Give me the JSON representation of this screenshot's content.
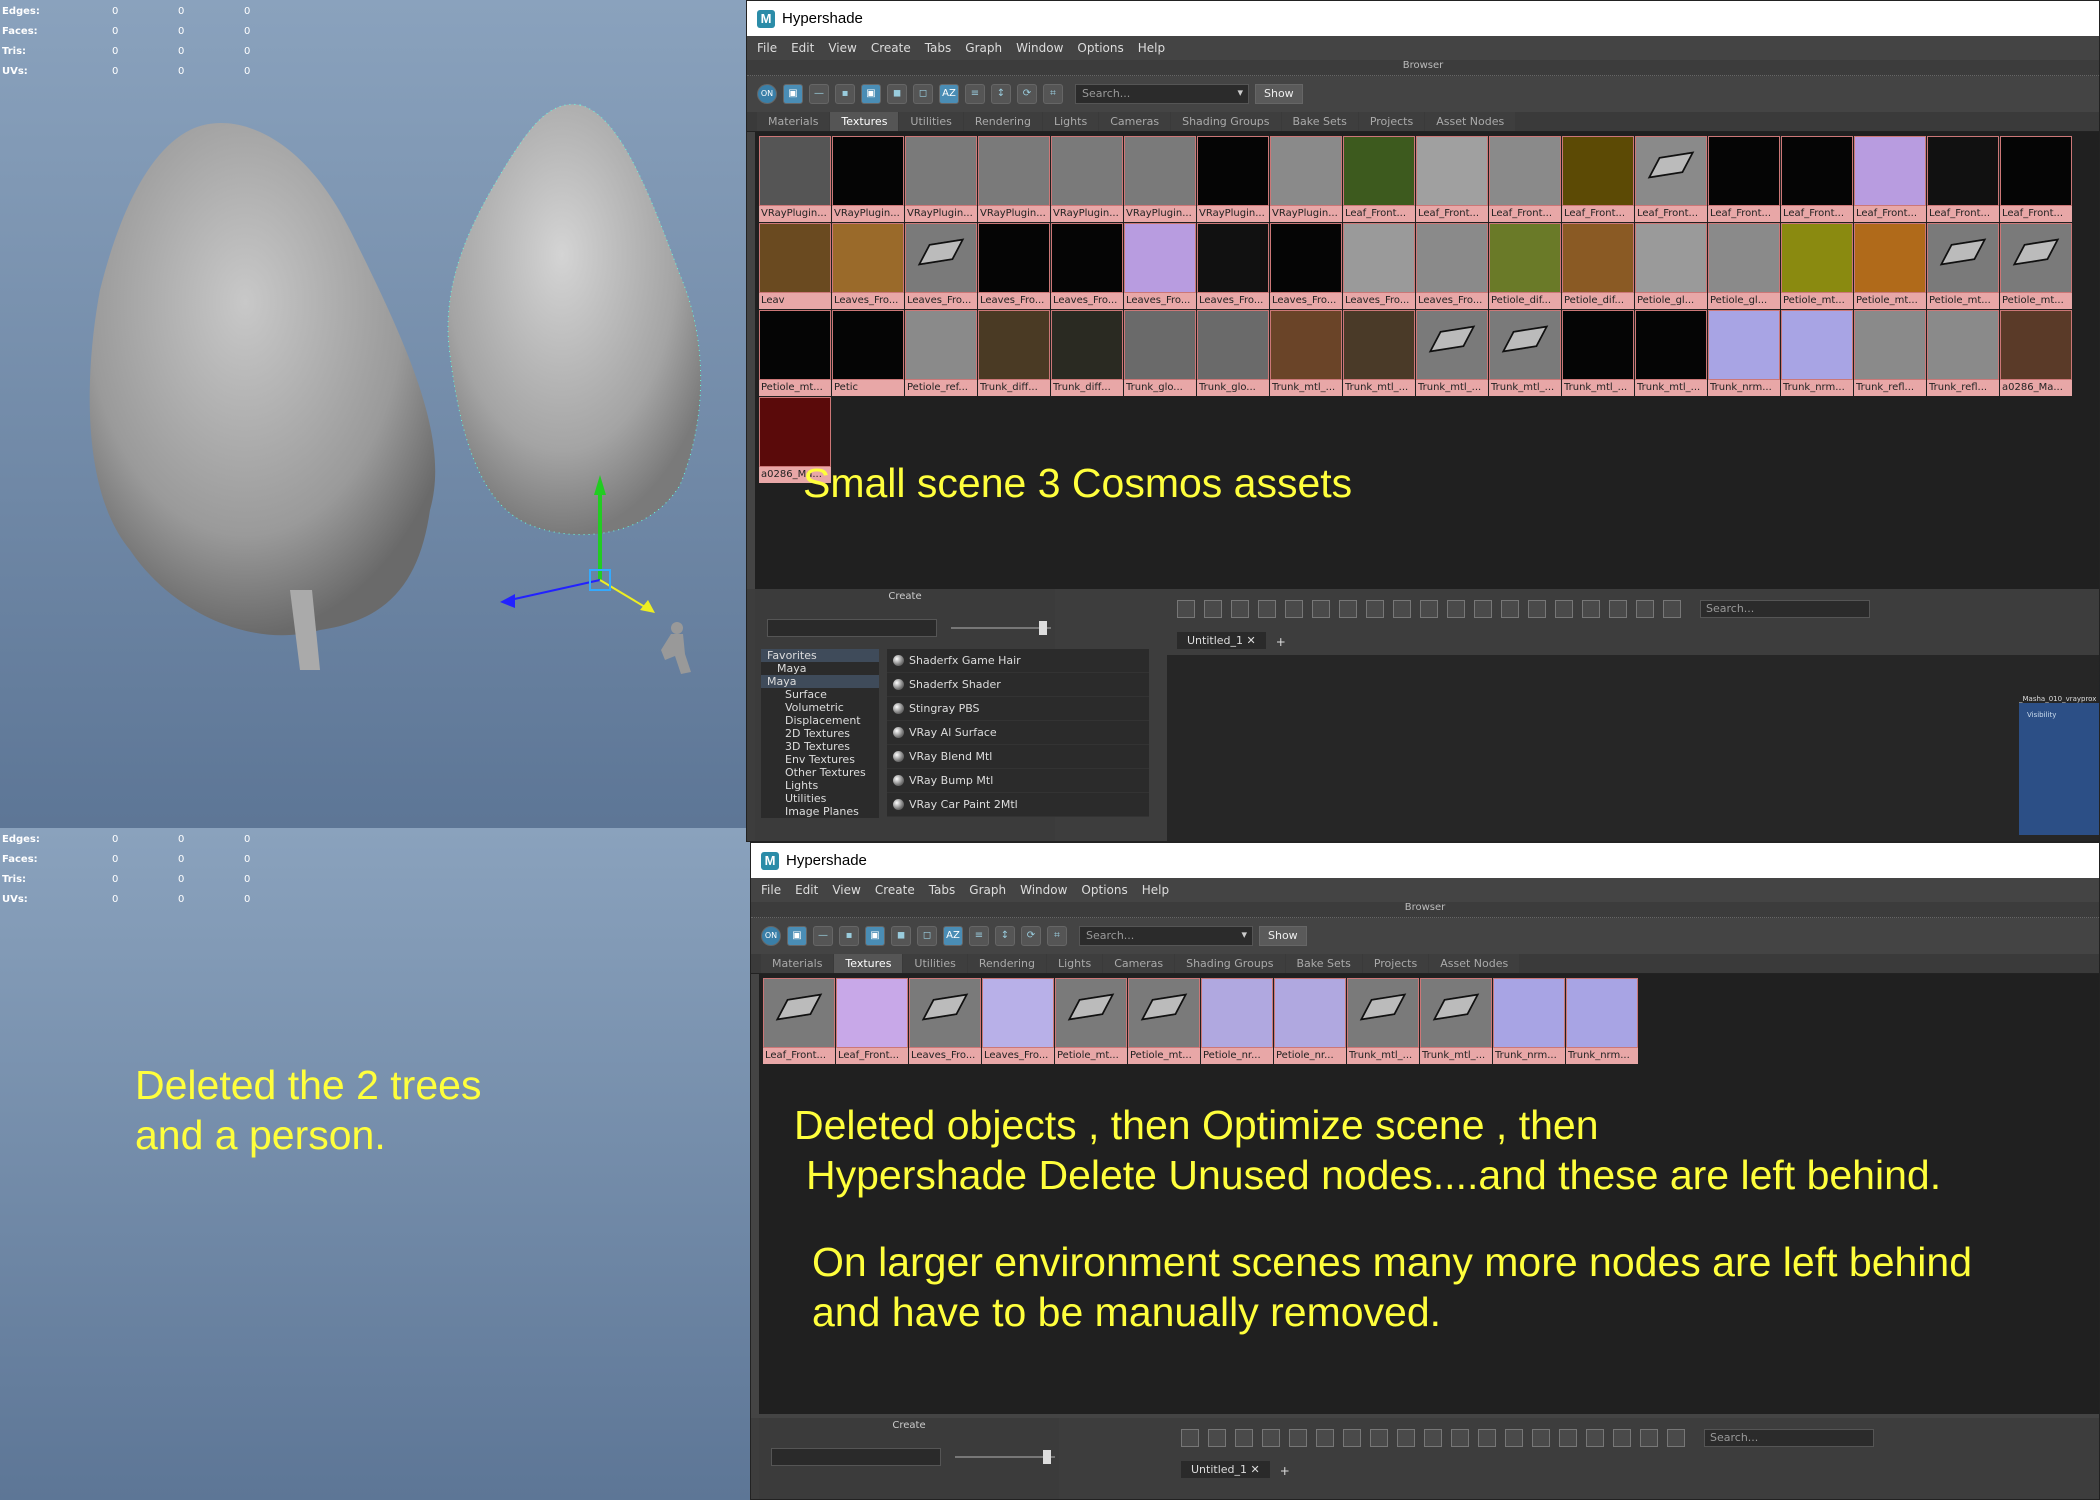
{
  "stats": {
    "rows": [
      {
        "label": "Edges:",
        "values": [
          "0",
          "0",
          "0"
        ]
      },
      {
        "label": "Faces:",
        "values": [
          "0",
          "0",
          "0"
        ]
      },
      {
        "label": "Tris:",
        "values": [
          "0",
          "0",
          "0"
        ]
      },
      {
        "label": "UVs:",
        "values": [
          "0",
          "0",
          "0"
        ]
      }
    ]
  },
  "top_window": {
    "title": "Hypershade",
    "menu": [
      "File",
      "Edit",
      "View",
      "Create",
      "Tabs",
      "Graph",
      "Window",
      "Options",
      "Help"
    ],
    "browser_label": "Browser",
    "search_placeholder": "Search...",
    "show_label": "Show",
    "tabs": [
      "Materials",
      "Textures",
      "Utilities",
      "Rendering",
      "Lights",
      "Cameras",
      "Shading Groups",
      "Bake Sets",
      "Projects",
      "Asset Nodes"
    ],
    "active_tab": "Textures",
    "swatches": [
      {
        "label": "VRayPlugin...",
        "color": "#555555"
      },
      {
        "label": "VRayPlugin...",
        "color": "#050505"
      },
      {
        "label": "VRayPlugin...",
        "color": "#7a7a7a"
      },
      {
        "label": "VRayPlugin...",
        "color": "#7a7a7a"
      },
      {
        "label": "VRayPlugin...",
        "color": "#7a7a7a"
      },
      {
        "label": "VRayPlugin...",
        "color": "#7a7a7a"
      },
      {
        "label": "VRayPlugin...",
        "color": "#050505"
      },
      {
        "label": "VRayPlugin...",
        "color": "#8a8a8a"
      },
      {
        "label": "Leaf_Front...",
        "color": "#3d5a1e"
      },
      {
        "label": "Leaf_Front...",
        "color": "#a0a0a0"
      },
      {
        "label": "Leaf_Front...",
        "color": "#8a8a8a"
      },
      {
        "label": "Leaf_Front...",
        "color": "#5c4a05"
      },
      {
        "label": "Leaf_Front...",
        "color": "#8a8a8a",
        "glyph": true
      },
      {
        "label": "Leaf_Front...",
        "color": "#050505"
      },
      {
        "label": "Leaf_Front...",
        "color": "#050505"
      },
      {
        "label": "Leaf_Front...",
        "color": "#b89ce0"
      },
      {
        "label": "Leaf_Front...",
        "color": "#111111"
      },
      {
        "label": "Leaf_Front...",
        "color": "#050505"
      },
      {
        "label": "Leav",
        "color": "#6a4a20"
      },
      {
        "label": "Leaves_Fro...",
        "color": "#9a6a2a"
      },
      {
        "label": "Leaves_Fro...",
        "color": "#7a7a7a",
        "glyph": true
      },
      {
        "label": "Leaves_Fro...",
        "color": "#050505"
      },
      {
        "label": "Leaves_Fro...",
        "color": "#050505"
      },
      {
        "label": "Leaves_Fro...",
        "color": "#b89ce0"
      },
      {
        "label": "Leaves_Fro...",
        "color": "#111111"
      },
      {
        "label": "Leaves_Fro...",
        "color": "#050505"
      },
      {
        "label": "Leaves_Fro...",
        "color": "#9a9a9a"
      },
      {
        "label": "Leaves_Fro...",
        "color": "#8a8a8a"
      },
      {
        "label": "Petiole_dif...",
        "color": "#6a7a28"
      },
      {
        "label": "Petiole_dif...",
        "color": "#8a5a24"
      },
      {
        "label": "Petiole_gl...",
        "color": "#9a9a9a"
      },
      {
        "label": "Petiole_gl...",
        "color": "#8a8a8a"
      },
      {
        "label": "Petiole_mt...",
        "color": "#8a8a10"
      },
      {
        "label": "Petiole_mt...",
        "color": "#b06a1a"
      },
      {
        "label": "Petiole_mt...",
        "color": "#7a7a7a",
        "glyph": true
      },
      {
        "label": "Petiole_mt...",
        "color": "#7a7a7a",
        "glyph": true
      },
      {
        "label": "Petiole_mt...",
        "color": "#050505"
      },
      {
        "label": "Petic",
        "color": "#050505"
      },
      {
        "label": "Petiole_ref...",
        "color": "#8a8a8a"
      },
      {
        "label": "Trunk_diff...",
        "color": "#4a3a24"
      },
      {
        "label": "Trunk_diff...",
        "color": "#2a2a22"
      },
      {
        "label": "Trunk_glo...",
        "color": "#6a6a6a"
      },
      {
        "label": "Trunk_glo...",
        "color": "#6a6a6a"
      },
      {
        "label": "Trunk_mtl_...",
        "color": "#6a4428"
      },
      {
        "label": "Trunk_mtl_...",
        "color": "#4a3a28"
      },
      {
        "label": "Trunk_mtl_...",
        "color": "#7a7a7a",
        "glyph": true
      },
      {
        "label": "Trunk_mtl_...",
        "color": "#7a7a7a",
        "glyph": true
      },
      {
        "label": "Trunk_mtl_...",
        "color": "#050505"
      },
      {
        "label": "Trunk_mtl_...",
        "color": "#050505"
      },
      {
        "label": "Trunk_nrm...",
        "color": "#a8a4e4"
      },
      {
        "label": "Trunk_nrm...",
        "color": "#a8a4e4"
      },
      {
        "label": "Trunk_refl...",
        "color": "#8a8a8a"
      },
      {
        "label": "Trunk_refl...",
        "color": "#8a8a8a"
      },
      {
        "label": "a0286_Ma...",
        "color": "#5a3a28"
      },
      {
        "label": "a0286_Ma...",
        "color": "#5a0a0a"
      }
    ],
    "annotation": "Small scene 3 Cosmos assets",
    "create_label": "Create",
    "create_tree": [
      {
        "label": "Favorites",
        "level": "hdr"
      },
      {
        "label": "Maya",
        "level": "hdr2"
      },
      {
        "label": "Maya",
        "level": "hdr"
      },
      {
        "label": "Surface",
        "level": "item"
      },
      {
        "label": "Volumetric",
        "level": "item"
      },
      {
        "label": "Displacement",
        "level": "item"
      },
      {
        "label": "2D Textures",
        "level": "item"
      },
      {
        "label": "3D Textures",
        "level": "item"
      },
      {
        "label": "Env Textures",
        "level": "item"
      },
      {
        "label": "Other Textures",
        "level": "item"
      },
      {
        "label": "Lights",
        "level": "item"
      },
      {
        "label": "Utilities",
        "level": "item"
      },
      {
        "label": "Image Planes",
        "level": "item"
      }
    ],
    "create_nodes": [
      "Shaderfx Game Hair",
      "Shaderfx Shader",
      "Stingray PBS",
      "VRay Al Surface",
      "VRay Blend Mtl",
      "VRay Bump Mtl",
      "VRay Car Paint 2Mtl"
    ],
    "graph_search_placeholder": "Search...",
    "graph_tab": "Untitled_1",
    "graph_tab_add": "+",
    "node_card": {
      "title": "_Masha_010_vrayprox",
      "attr": "Visibility"
    }
  },
  "bottom_window": {
    "title": "Hypershade",
    "menu": [
      "File",
      "Edit",
      "View",
      "Create",
      "Tabs",
      "Graph",
      "Window",
      "Options",
      "Help"
    ],
    "browser_label": "Browser",
    "search_placeholder": "Search...",
    "show_label": "Show",
    "tabs": [
      "Materials",
      "Textures",
      "Utilities",
      "Rendering",
      "Lights",
      "Cameras",
      "Shading Groups",
      "Bake Sets",
      "Projects",
      "Asset Nodes"
    ],
    "active_tab": "Textures",
    "swatches": [
      {
        "label": "Leaf_Front...",
        "color": "#7a7a7a",
        "glyph": true
      },
      {
        "label": "Leaf_Front...",
        "color": "#c8a8e8"
      },
      {
        "label": "Leaves_Fro...",
        "color": "#7a7a7a",
        "glyph": true
      },
      {
        "label": "Leaves_Fro...",
        "color": "#b8b0e8"
      },
      {
        "label": "Petiole_mt...",
        "color": "#7a7a7a",
        "glyph": true
      },
      {
        "label": "Petiole_mt...",
        "color": "#7a7a7a",
        "glyph": true
      },
      {
        "label": "Petiole_nr...",
        "color": "#b0a8e0"
      },
      {
        "label": "Petiole_nr...",
        "color": "#b0a8e0"
      },
      {
        "label": "Trunk_mtl_...",
        "color": "#7a7a7a",
        "glyph": true
      },
      {
        "label": "Trunk_mtl_...",
        "color": "#7a7a7a",
        "glyph": true
      },
      {
        "label": "Trunk_nrm...",
        "color": "#a8a4e4"
      },
      {
        "label": "Trunk_nrm...",
        "color": "#a8a4e4"
      }
    ],
    "annotation_1a": "Deleted objects , then Optimize scene , then",
    "annotation_1b": "Hypershade Delete Unused nodes....and these are left behind.",
    "annotation_2a": "On larger environment scenes many more nodes are left behind",
    "annotation_2b": "and have to be manually removed.",
    "create_label": "Create",
    "graph_search_placeholder": "Search...",
    "graph_tab": "Untitled_1",
    "graph_tab_add": "+"
  },
  "viewport_annotation": {
    "line1": "Deleted the 2 trees",
    "line2": "and a person."
  },
  "colors": {
    "annotation": "#ffff3c",
    "caption_bg": "#e8a7a7"
  }
}
